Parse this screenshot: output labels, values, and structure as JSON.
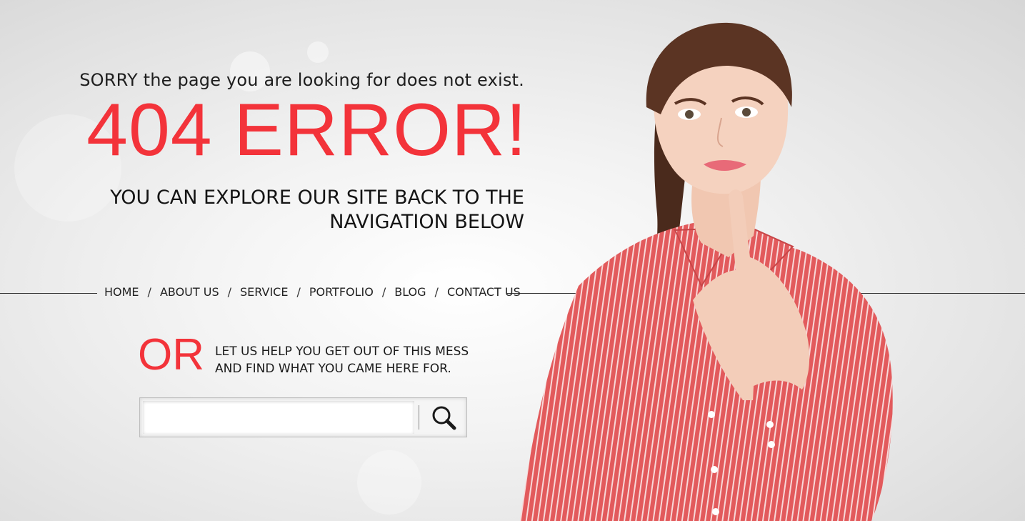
{
  "message": {
    "sorry": "SORRY the page you are looking for does not exist.",
    "error_title": "404 ERROR!",
    "explore_line1": "YOU CAN EXPLORE OUR SITE BACK TO THE",
    "explore_line2": "NAVIGATION BELOW"
  },
  "nav": {
    "items": [
      {
        "label": "HOME"
      },
      {
        "label": "ABOUT US"
      },
      {
        "label": "SERVICE"
      },
      {
        "label": "PORTFOLIO"
      },
      {
        "label": "BLOG"
      },
      {
        "label": "CONTACT US"
      }
    ],
    "separator": "/"
  },
  "alternative": {
    "or_label": "OR",
    "help_line1": "LET US HELP YOU GET OUT OF THIS MESS",
    "help_line2": "AND FIND WHAT YOU CAME HERE FOR."
  },
  "search": {
    "value": "",
    "placeholder": "",
    "icon": "magnifier-icon"
  },
  "colors": {
    "accent": "#f3333a",
    "text": "#1e1e1e",
    "shirt": "#e0575a"
  }
}
